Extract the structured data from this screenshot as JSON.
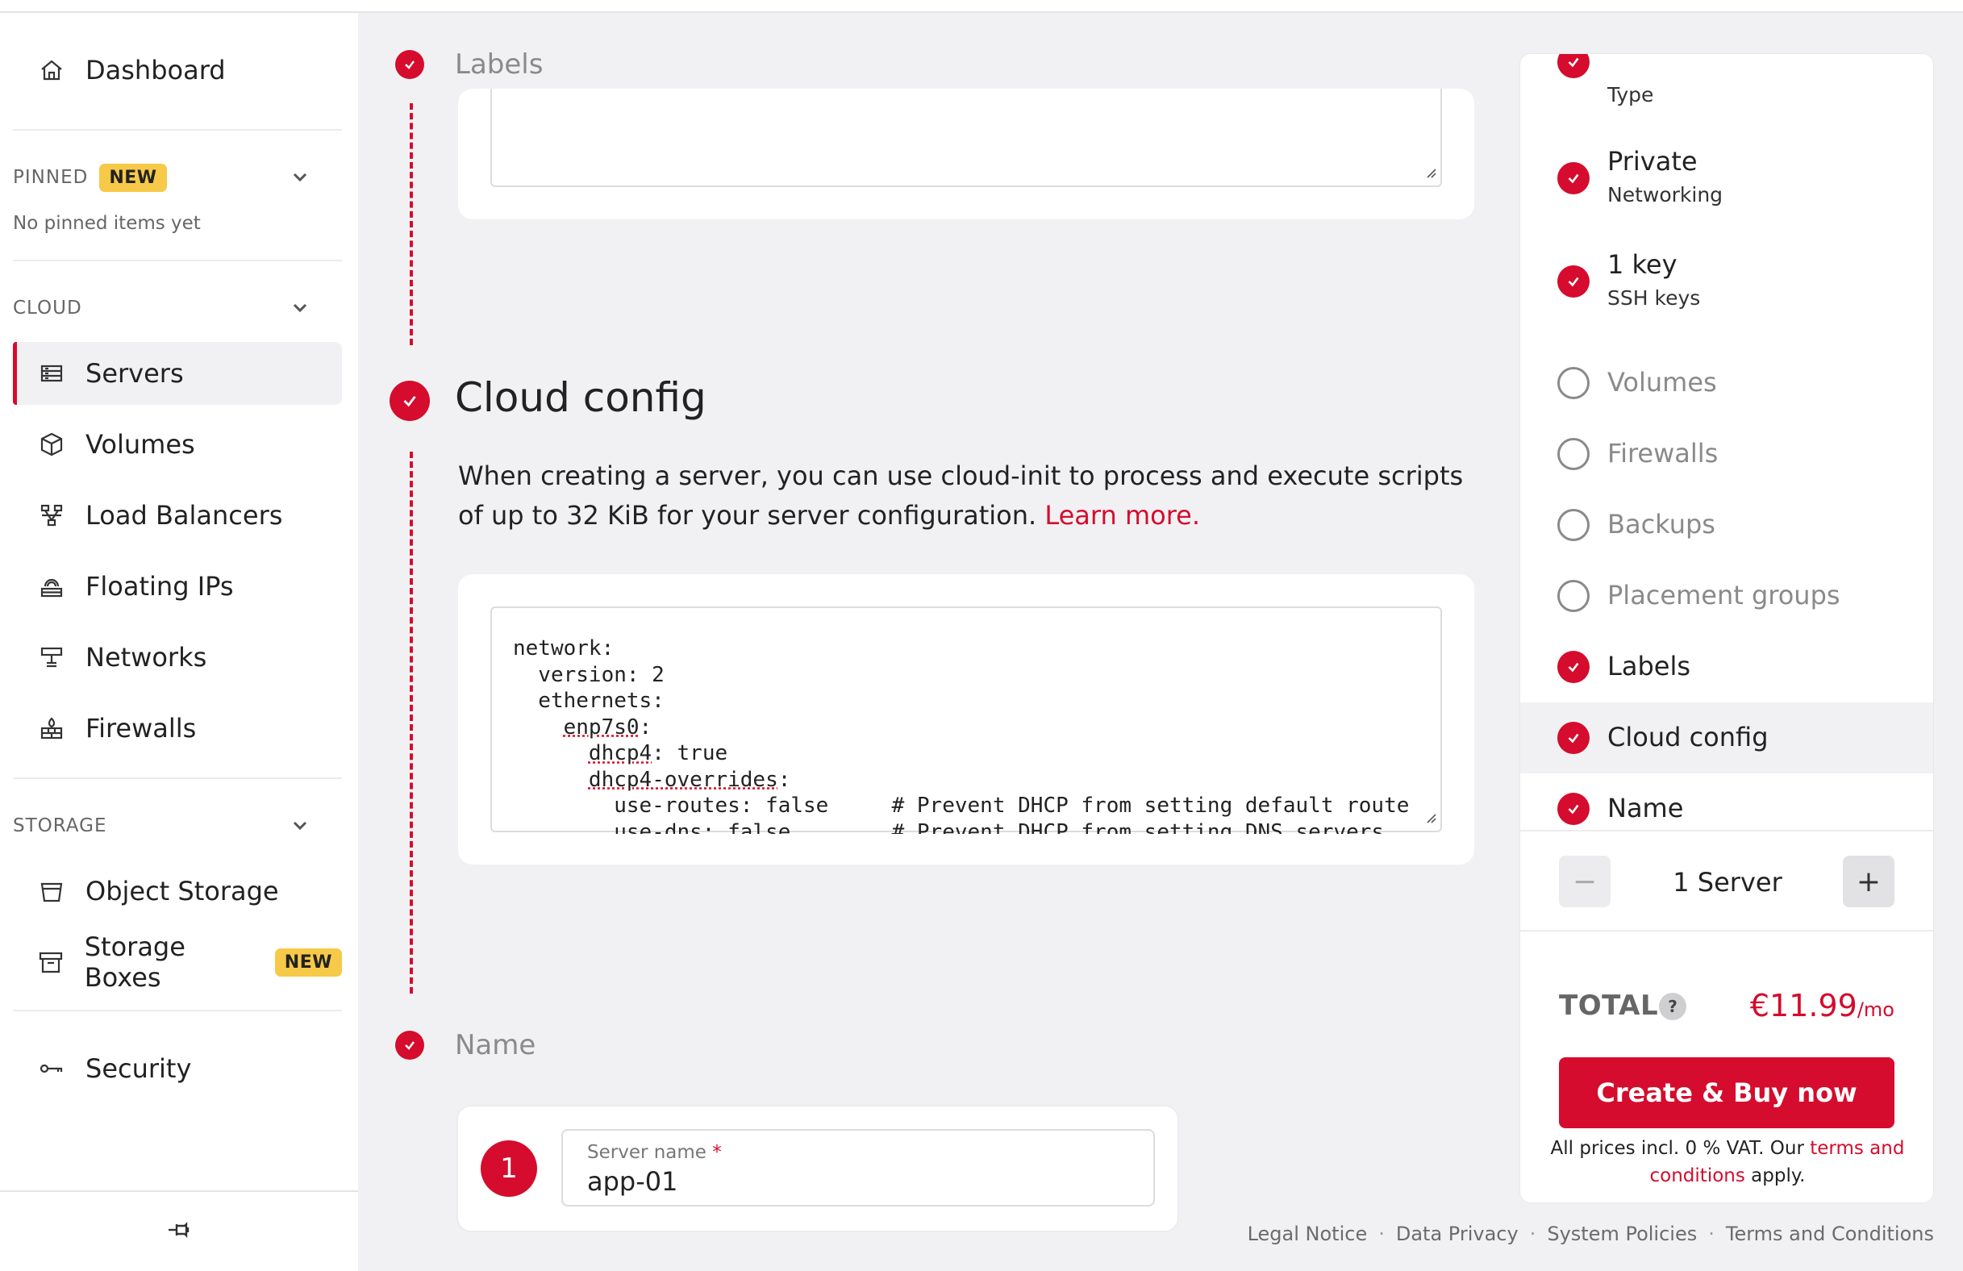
{
  "sidebar": {
    "dashboard": "Dashboard",
    "pinned_header": "PINNED",
    "pinned_badge": "NEW",
    "pinned_empty": "No pinned items yet",
    "cloud_header": "CLOUD",
    "cloud_items": {
      "servers": "Servers",
      "volumes": "Volumes",
      "load_balancers": "Load Balancers",
      "floating_ips": "Floating IPs",
      "networks": "Networks",
      "firewalls": "Firewalls"
    },
    "storage_header": "STORAGE",
    "storage_items": {
      "object_storage": "Object Storage",
      "storage_boxes": "Storage Boxes",
      "storage_boxes_badge": "NEW"
    },
    "security": "Security"
  },
  "main": {
    "labels_title": "Labels",
    "cloud_config_title": "Cloud config",
    "cloud_config_desc": "When creating a server, you can use cloud-init to process and execute scripts of up to 32 KiB for your server configuration.",
    "learn_more": "Learn more.",
    "code": {
      "l1": "network:",
      "l2": "  version: 2",
      "l3": "  ethernets:",
      "l4_indent": "    ",
      "l4_word": "enp7s0",
      "l4_rest": ":",
      "l5_indent": "      ",
      "l5_word": "dhcp4",
      "l5_rest": ": true",
      "l6_indent": "      ",
      "l6_word": "dhcp4-overrides",
      "l6_rest": ":",
      "l7": "        use-routes: false     # Prevent DHCP from setting default route",
      "l8": "        use-dns: false        # Prevent DHCP from setting DNS servers"
    },
    "name_title": "Name",
    "server_index": "1",
    "server_name_label": "Server name",
    "server_name_required": "*",
    "server_name_value": "app-01"
  },
  "summary": {
    "type_label": "Type",
    "private_networking_title": "Private",
    "private_networking_sub": "Networking",
    "ssh_title": "1 key",
    "ssh_sub": "SSH keys",
    "volumes": "Volumes",
    "firewalls": "Firewalls",
    "backups": "Backups",
    "placement_groups": "Placement groups",
    "labels": "Labels",
    "cloud_config": "Cloud config",
    "name": "Name",
    "minus": "−",
    "plus": "+",
    "server_count": "1 Server",
    "total_label": "TOTAL",
    "help": "?",
    "price": "€11.99",
    "price_unit": "/mo",
    "buy_button": "Create & Buy now",
    "vat_text": "All prices incl. 0 % VAT. Our",
    "vat_link": "terms and conditions",
    "vat_end": "apply."
  },
  "footer": {
    "legal": "Legal Notice",
    "privacy": "Data Privacy",
    "policies": "System Policies",
    "terms": "Terms and Conditions",
    "sep": "·"
  },
  "colors": {
    "accent": "#d50c2d",
    "badge": "#f7c948",
    "background": "#f1f1f3"
  }
}
